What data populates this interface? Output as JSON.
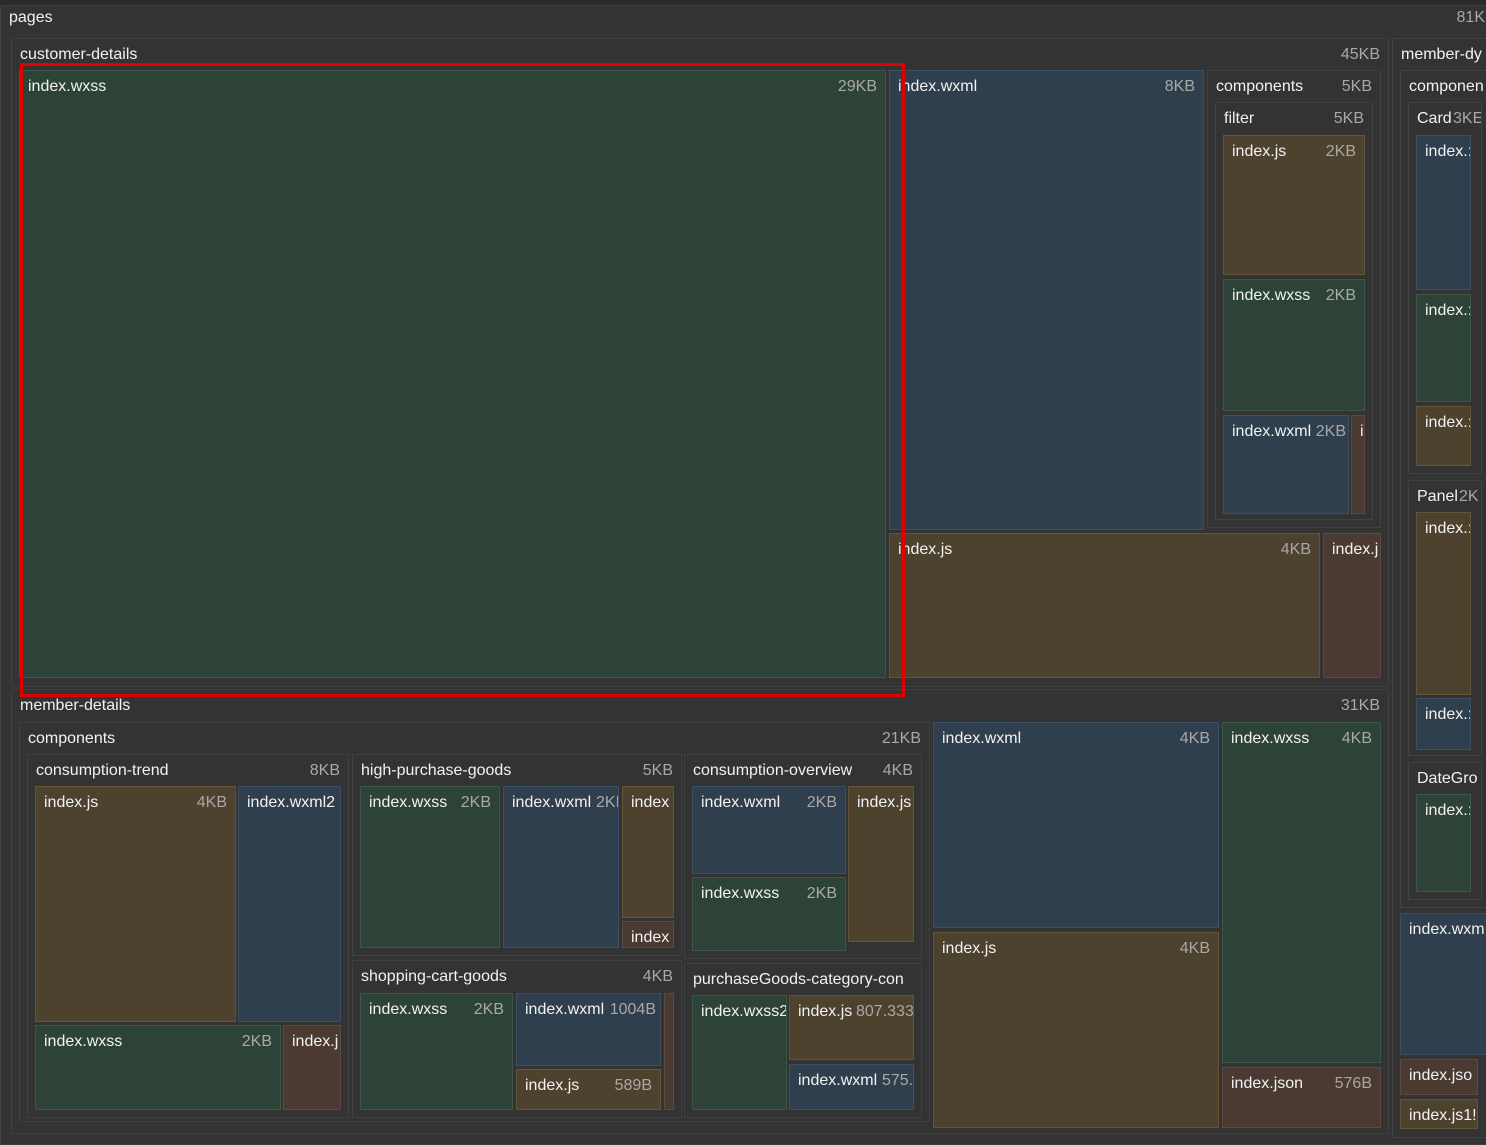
{
  "pages": {
    "label": "pages",
    "size": "81K"
  },
  "customer_details": {
    "label": "customer-details",
    "size": "45KB",
    "wxss": {
      "label": "index.wxss",
      "size": "29KB"
    },
    "wxml": {
      "label": "index.wxml",
      "size": "8KB"
    },
    "components": {
      "label": "components",
      "size": "5KB",
      "filter": {
        "label": "filter",
        "size": "5KB",
        "js": {
          "label": "index.js",
          "size": "2KB"
        },
        "wxss": {
          "label": "index.wxss",
          "size": "2KB"
        },
        "wxml": {
          "label": "index.wxml",
          "size": "2KB"
        },
        "small": {
          "label": "i"
        }
      }
    },
    "js": {
      "label": "index.js",
      "size": "4KB"
    },
    "js2": {
      "label": "index.j"
    }
  },
  "member_dy": {
    "label": "member-dy",
    "components": {
      "label": "componen",
      "card": {
        "label": "Card",
        "size": "3KE",
        "f1": "index.:",
        "f2": "index.:",
        "f3": "index.:"
      },
      "panel": {
        "label": "Panel",
        "size": "2K",
        "f1": "index.:",
        "f2": "index.:"
      },
      "dategro": {
        "label": "DateGro",
        "f1": "index.:"
      }
    },
    "wxml": "index.wxm",
    "json": "index.jso",
    "js": "index.js1!"
  },
  "member_details": {
    "label": "member-details",
    "size": "31KB",
    "components": {
      "label": "components",
      "size": "21KB",
      "consumption_trend": {
        "label": "consumption-trend",
        "size": "8KB",
        "js": {
          "label": "index.js",
          "size": "4KB"
        },
        "wxml": {
          "label": "index.wxml2"
        },
        "wxss": {
          "label": "index.wxss",
          "size": "2KB"
        },
        "js2": {
          "label": "index.j"
        }
      },
      "high_purchase_goods": {
        "label": "high-purchase-goods",
        "size": "5KB",
        "wxss": {
          "label": "index.wxss",
          "size": "2KB"
        },
        "wxml": {
          "label": "index.wxml",
          "size": "2KI"
        },
        "f3": {
          "label": "index"
        },
        "f4": {
          "label": "index"
        }
      },
      "consumption_overview": {
        "label": "consumption-overview",
        "size": "4KB",
        "wxml": {
          "label": "index.wxml",
          "size": "2KB"
        },
        "js": {
          "label": "index.js"
        },
        "wxss": {
          "label": "index.wxss",
          "size": "2KB"
        }
      },
      "shopping_cart_goods": {
        "label": "shopping-cart-goods",
        "size": "4KB",
        "wxss": {
          "label": "index.wxss",
          "size": "2KB"
        },
        "wxml": {
          "label": "index.wxml",
          "size": "1004B"
        },
        "js": {
          "label": "index.js",
          "size": "589B"
        }
      },
      "purchase_goods": {
        "label": "purchaseGoods-category-con",
        "wxss": {
          "label": "index.wxss2"
        },
        "js": {
          "label": "index.js",
          "size": "807.333"
        },
        "wxml": {
          "label": "index.wxml",
          "size": "575."
        }
      }
    },
    "wxml": {
      "label": "index.wxml",
      "size": "4KB"
    },
    "wxss": {
      "label": "index.wxss",
      "size": "4KB"
    },
    "js": {
      "label": "index.js",
      "size": "4KB"
    },
    "json": {
      "label": "index.json",
      "size": "576B"
    }
  },
  "colors": {
    "wxss": "#2e4338",
    "wxml": "#2f3f4d",
    "js": "#4d422e",
    "json": "#4a3a32",
    "dir": "#333333",
    "highlight": "#e00000"
  }
}
